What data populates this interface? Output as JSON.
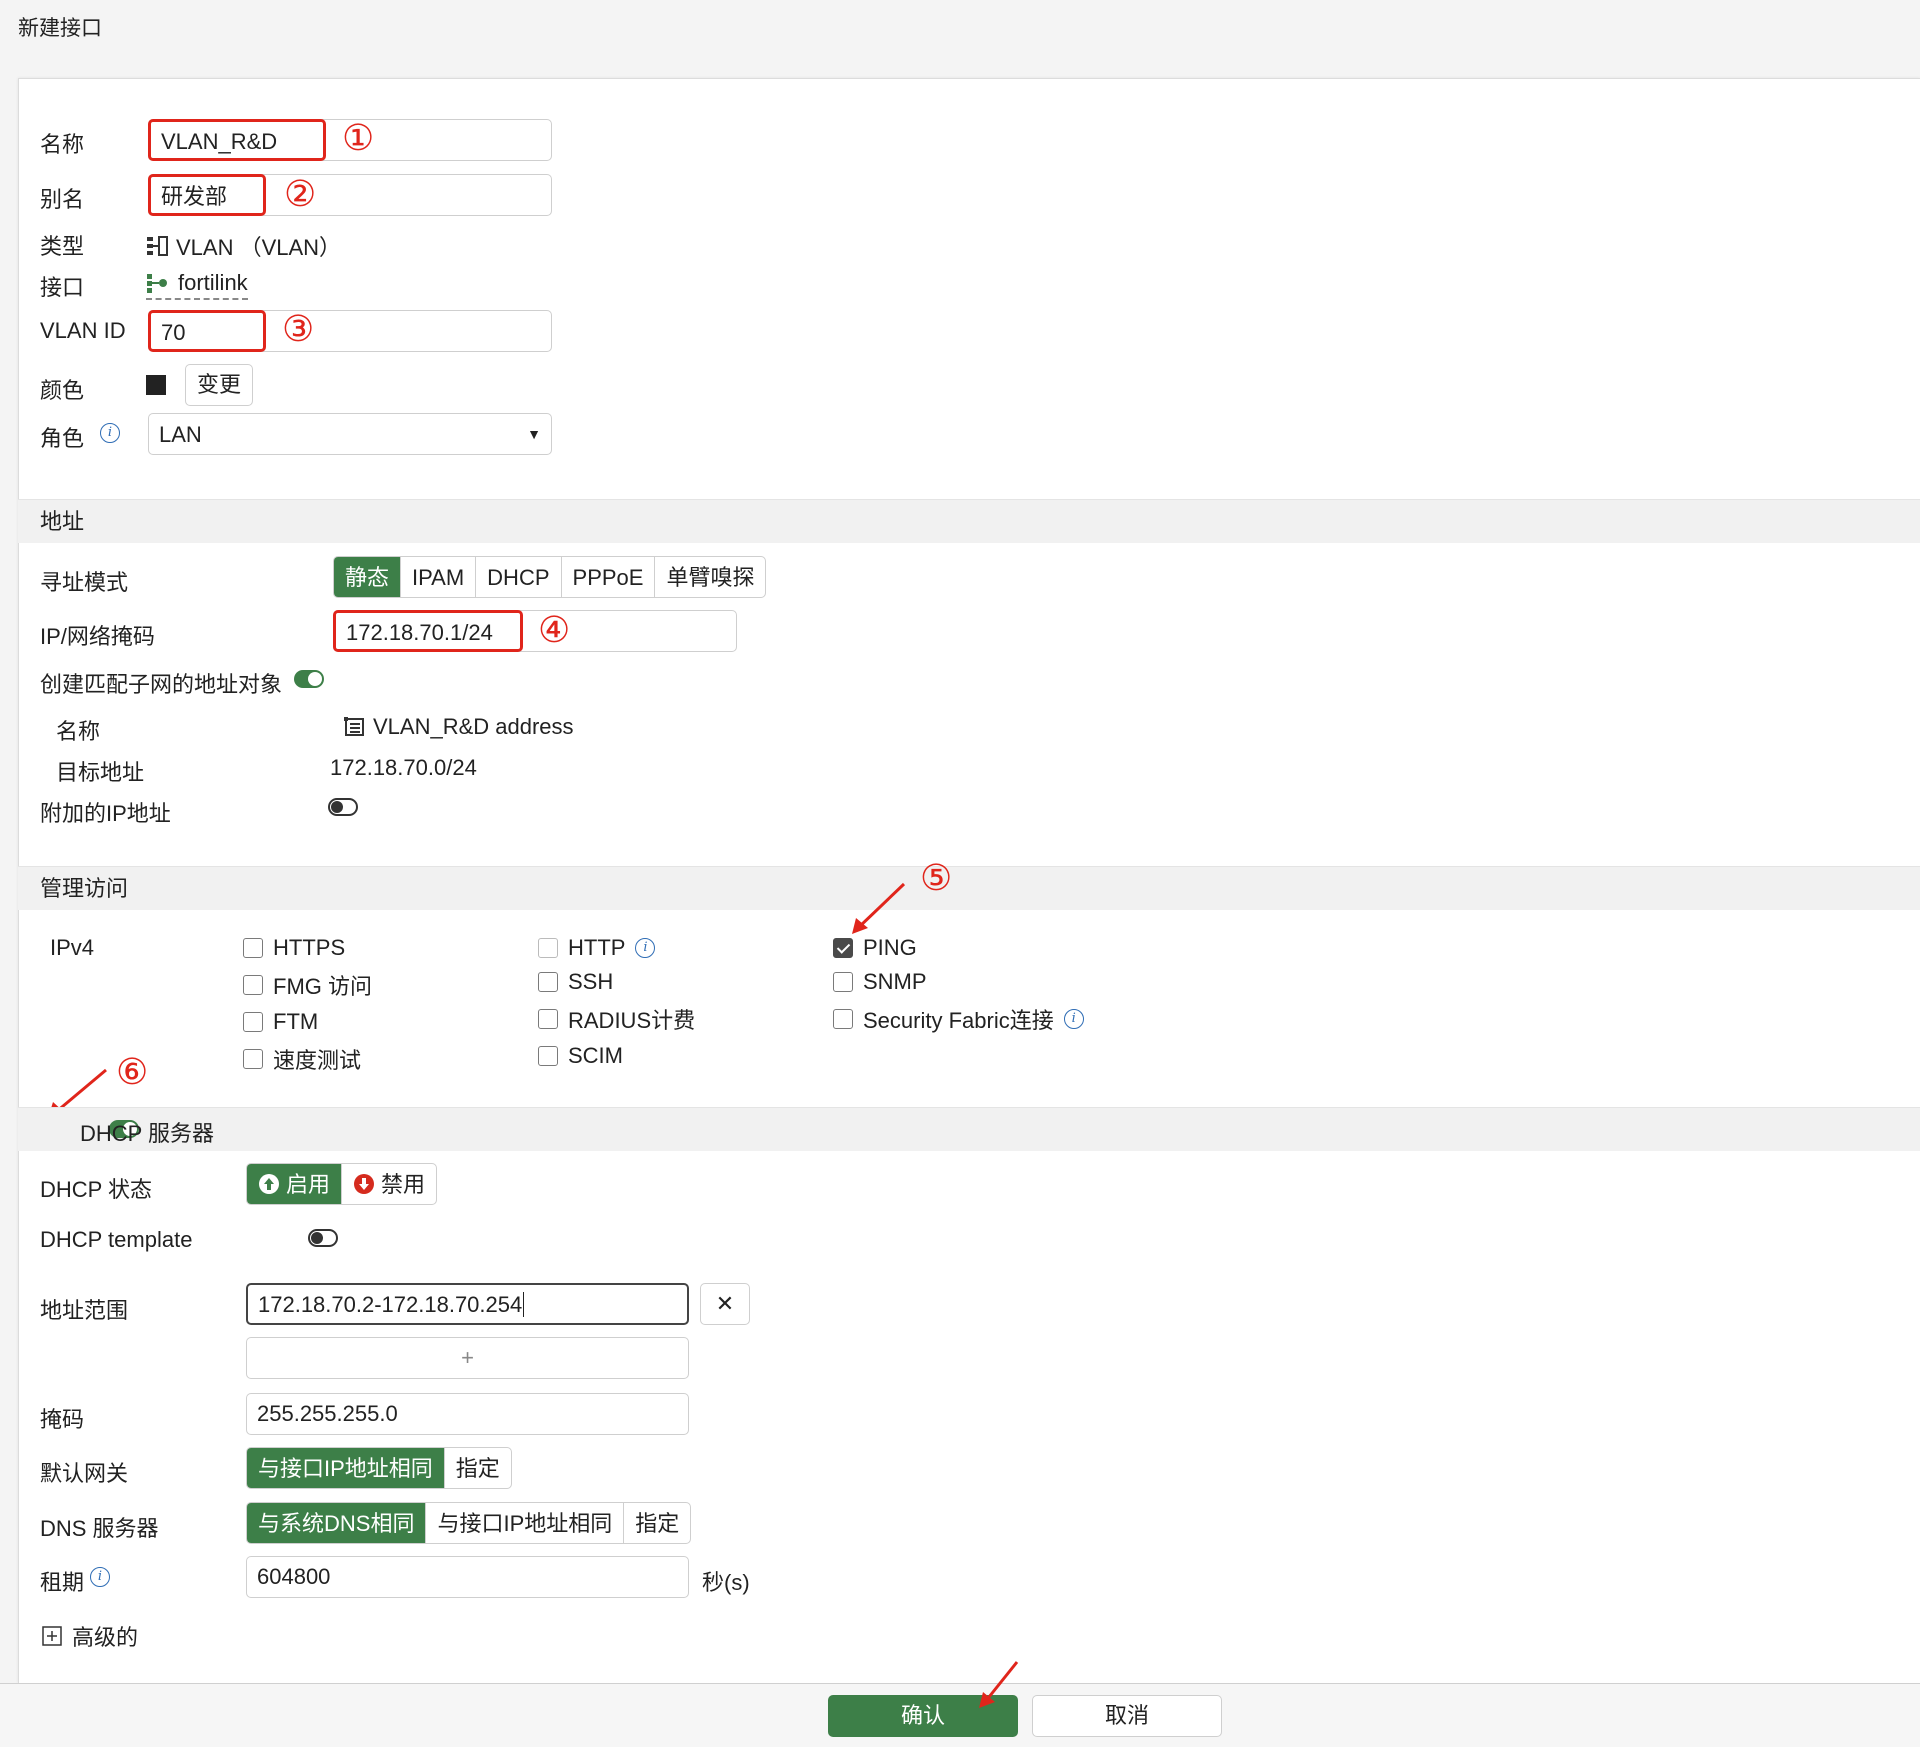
{
  "page_title": "新建接口",
  "general": {
    "name_label": "名称",
    "name_value": "VLAN_R&D",
    "alias_label": "别名",
    "alias_value": "研发部",
    "type_label": "类型",
    "type_value": "VLAN （VLAN）",
    "interface_label": "接口",
    "interface_value": "fortilink",
    "vlan_id_label": "VLAN ID",
    "vlan_id_value": "70",
    "color_label": "颜色",
    "color_change_button": "变更",
    "role_label": "角色",
    "role_value": "LAN"
  },
  "address": {
    "section_title": "地址",
    "mode_label": "寻址模式",
    "modes": [
      "静态",
      "IPAM",
      "DHCP",
      "PPPoE",
      "单臂嗅探"
    ],
    "ip_label": "IP/网络掩码",
    "ip_value": "172.18.70.1/24",
    "create_object_label": "创建匹配子网的地址对象",
    "obj_name_label": "名称",
    "obj_name_value": "VLAN_R&D address",
    "dest_label": "目标地址",
    "dest_value": "172.18.70.0/24",
    "secondary_ip_label": "附加的IP地址"
  },
  "admin_access": {
    "section_title": "管理访问",
    "ipv4_label": "IPv4",
    "col1": [
      "HTTPS",
      "FMG 访问",
      "FTM",
      "速度测试"
    ],
    "col2": [
      "HTTP",
      "SSH",
      "RADIUS计费",
      "SCIM"
    ],
    "col3": [
      "PING",
      "SNMP",
      "Security Fabric连接"
    ],
    "checked": [
      "PING"
    ]
  },
  "dhcp": {
    "section_title": "DHCP 服务器",
    "status_label": "DHCP 状态",
    "enable_label": "启用",
    "disable_label": "禁用",
    "template_label": "DHCP template",
    "range_label": "地址范围",
    "range_value": "172.18.70.2-172.18.70.254",
    "add_symbol": "+",
    "mask_label": "掩码",
    "mask_value": "255.255.255.0",
    "gateway_label": "默认网关",
    "gateway_options": [
      "与接口IP地址相同",
      "指定"
    ],
    "dns_label": "DNS 服务器",
    "dns_options": [
      "与系统DNS相同",
      "与接口IP地址相同",
      "指定"
    ],
    "lease_label": "租期",
    "lease_value": "604800",
    "lease_unit": "秒(s)",
    "advanced_label": "高级的"
  },
  "annotations": [
    "①",
    "②",
    "③",
    "④",
    "⑤",
    "⑥"
  ],
  "footer": {
    "ok": "确认",
    "cancel": "取消"
  },
  "colors": {
    "accent_green": "#3d7f48",
    "annotation_red": "#e0251b",
    "info_blue": "#2f6db5"
  }
}
